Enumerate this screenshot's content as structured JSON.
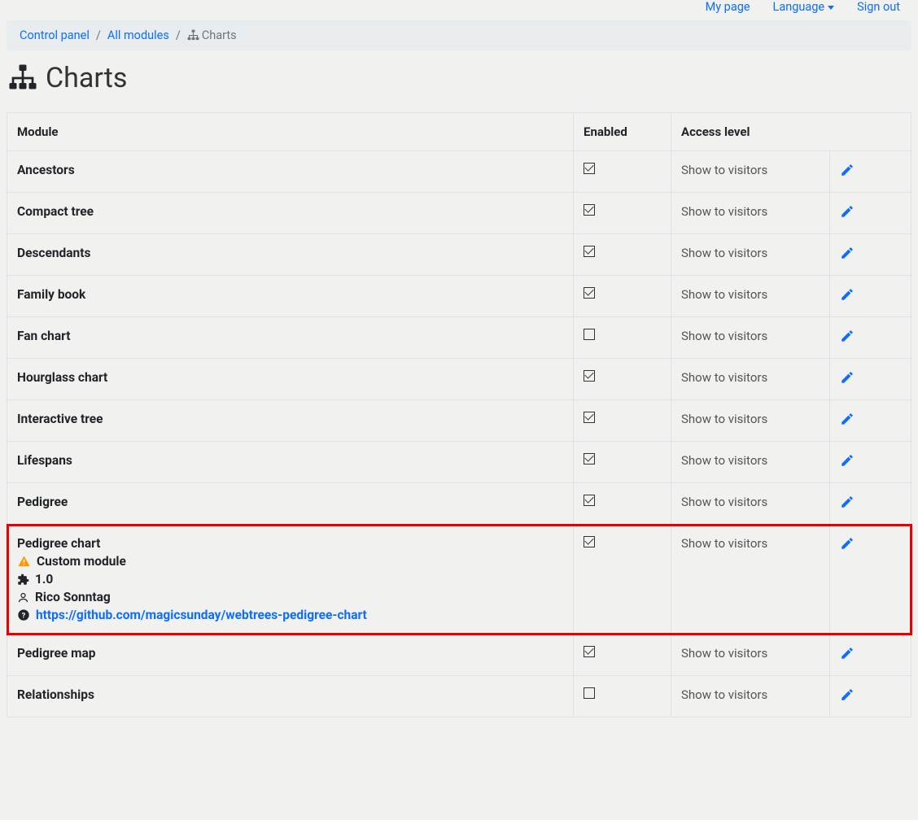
{
  "topnav": {
    "my_page": "My page",
    "language": "Language",
    "sign_out": "Sign out"
  },
  "breadcrumb": {
    "control_panel": "Control panel",
    "all_modules": "All modules",
    "current": "Charts"
  },
  "page_title": "Charts",
  "table": {
    "headers": {
      "module": "Module",
      "enabled": "Enabled",
      "access": "Access level"
    },
    "rows": [
      {
        "name": "Ancestors",
        "enabled": true,
        "access": "Show to visitors"
      },
      {
        "name": "Compact tree",
        "enabled": true,
        "access": "Show to visitors"
      },
      {
        "name": "Descendants",
        "enabled": true,
        "access": "Show to visitors"
      },
      {
        "name": "Family book",
        "enabled": true,
        "access": "Show to visitors"
      },
      {
        "name": "Fan chart",
        "enabled": false,
        "access": "Show to visitors"
      },
      {
        "name": "Hourglass chart",
        "enabled": true,
        "access": "Show to visitors"
      },
      {
        "name": "Interactive tree",
        "enabled": true,
        "access": "Show to visitors"
      },
      {
        "name": "Lifespans",
        "enabled": true,
        "access": "Show to visitors"
      },
      {
        "name": "Pedigree",
        "enabled": true,
        "access": "Show to visitors"
      },
      {
        "name": "Pedigree chart",
        "enabled": true,
        "access": "Show to visitors",
        "highlight": true,
        "custom": {
          "label": "Custom module",
          "version": "1.0",
          "author": "Rico Sonntag",
          "url": "https://github.com/magicsunday/webtrees-pedigree-chart"
        }
      },
      {
        "name": "Pedigree map",
        "enabled": true,
        "access": "Show to visitors"
      },
      {
        "name": "Relationships",
        "enabled": false,
        "access": "Show to visitors"
      }
    ]
  }
}
